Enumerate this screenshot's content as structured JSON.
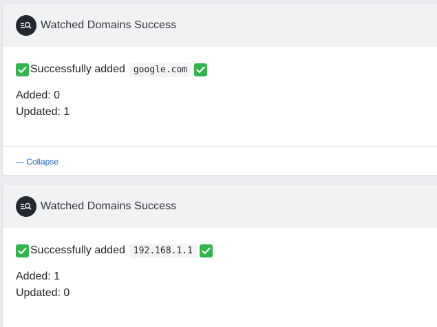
{
  "cards": [
    {
      "title": "Watched Domains Success",
      "message_prefix": "Successfully added",
      "domain": "google.com",
      "added": "Added: 0",
      "updated": "Updated: 1",
      "collapse_label": "— Collapse"
    },
    {
      "title": "Watched Domains Success",
      "message_prefix": "Successfully added",
      "domain": "192.168.1.1",
      "added": "Added: 1",
      "updated": "Updated: 0"
    }
  ],
  "icons": {
    "app_avatar": "search-list-icon",
    "status": "green-check-icon"
  },
  "colors": {
    "check": "#30b64a",
    "link": "#1565c0",
    "header_bg": "#f1f2f4",
    "avatar_bg": "#23272e"
  }
}
